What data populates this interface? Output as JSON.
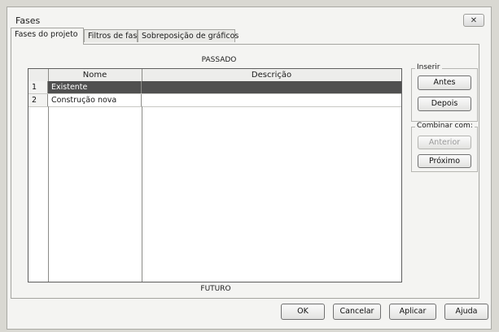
{
  "window": {
    "title": "Fases",
    "close_label": "✕"
  },
  "tabs": [
    {
      "label": "Fases do projeto",
      "active": true
    },
    {
      "label": "Filtros de fase",
      "active": false
    },
    {
      "label": "Sobreposição de gráficos",
      "active": false
    }
  ],
  "phases": {
    "top_label": "PASSADO",
    "bottom_label": "FUTURO",
    "columns": {
      "index": "",
      "name": "Nome",
      "description": "Descrição"
    },
    "rows": [
      {
        "index": "1",
        "name": "Existente",
        "description": "",
        "selected": true
      },
      {
        "index": "2",
        "name": "Construção nova",
        "description": "",
        "selected": false
      }
    ]
  },
  "insert": {
    "label": "Inserir",
    "before": "Antes",
    "after": "Depois"
  },
  "combine": {
    "label": "Combinar com:",
    "previous": "Anterior",
    "next": "Próximo"
  },
  "footer": {
    "ok": "OK",
    "cancel": "Cancelar",
    "apply": "Aplicar",
    "help": "Ajuda"
  },
  "colors": {
    "selected_row": "#505050",
    "dialog_bg": "#f4f4f2"
  }
}
